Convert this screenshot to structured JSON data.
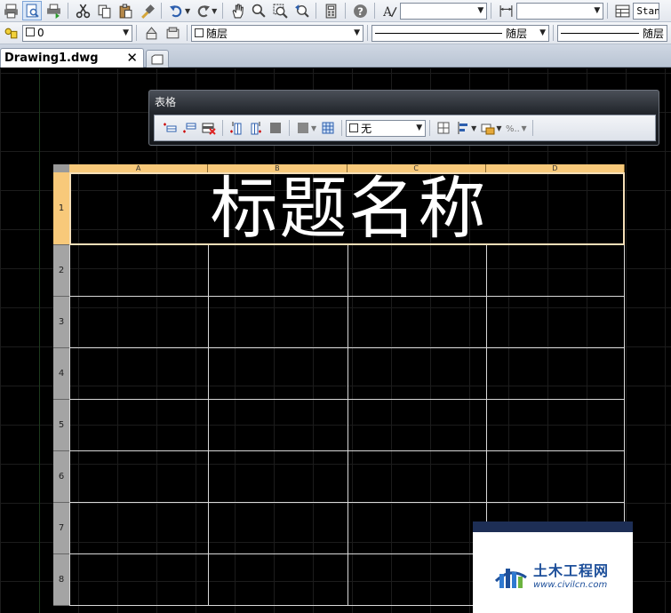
{
  "toolbar_top": {
    "textstyle_value": "",
    "dimstyle_value": "",
    "tablestyle_value": "Stan"
  },
  "toolbar_layer": {
    "layer_value": "0",
    "color_value": "随层",
    "linetype_value": "随层",
    "lineweight_value": "随层"
  },
  "tabs": {
    "document": "Drawing1.dwg",
    "close_glyph": "✕"
  },
  "table_toolbar": {
    "title": "表格",
    "border_combo_value": "无"
  },
  "table": {
    "columns": [
      "A",
      "B",
      "C",
      "D"
    ],
    "rows": [
      "1",
      "2",
      "3",
      "4",
      "5",
      "6",
      "7",
      "8"
    ],
    "title_text": "标题名称"
  },
  "watermark": {
    "name_cn": "土木工程网",
    "url": "www.civilcn.com"
  },
  "colors": {
    "canvas_bg": "#000000",
    "grid": "#1c1c1c",
    "header_selected": "#f8c97a",
    "title_border": "#f5dfb8"
  }
}
